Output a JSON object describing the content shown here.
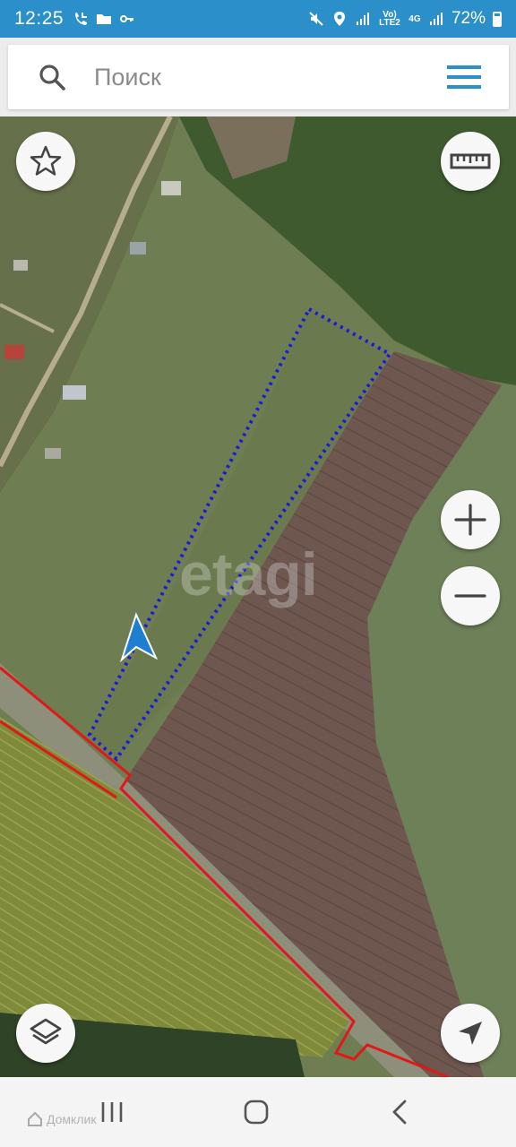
{
  "status_bar": {
    "time": "12:25",
    "network": "Vo) LTE2",
    "network_type": "4G",
    "battery": "72%",
    "left_icons": [
      "missed-call-icon",
      "folder-icon",
      "key-icon"
    ],
    "right_icons": [
      "mute-icon",
      "location-icon",
      "signal-icon",
      "signal-icon",
      "battery-icon"
    ]
  },
  "search": {
    "placeholder": "Поиск",
    "value": ""
  },
  "map": {
    "watermark": "etagi",
    "controls": {
      "favorite": "star-icon",
      "ruler": "ruler-icon",
      "zoom_in": "plus-icon",
      "zoom_out": "minus-icon",
      "layers": "layers-icon",
      "locate": "navigation-arrow-icon"
    },
    "colors": {
      "plot_outline": "#1a1adc",
      "boundary": "#e01818",
      "user_marker": "#1e7fd0"
    }
  },
  "nav_bar": {
    "buttons": [
      "recent-apps-icon",
      "home-icon",
      "back-icon"
    ],
    "site_watermark": "Домклик"
  },
  "colors": {
    "status_bar": "#2b8fc9",
    "menu_icon": "#2b8fc9"
  }
}
